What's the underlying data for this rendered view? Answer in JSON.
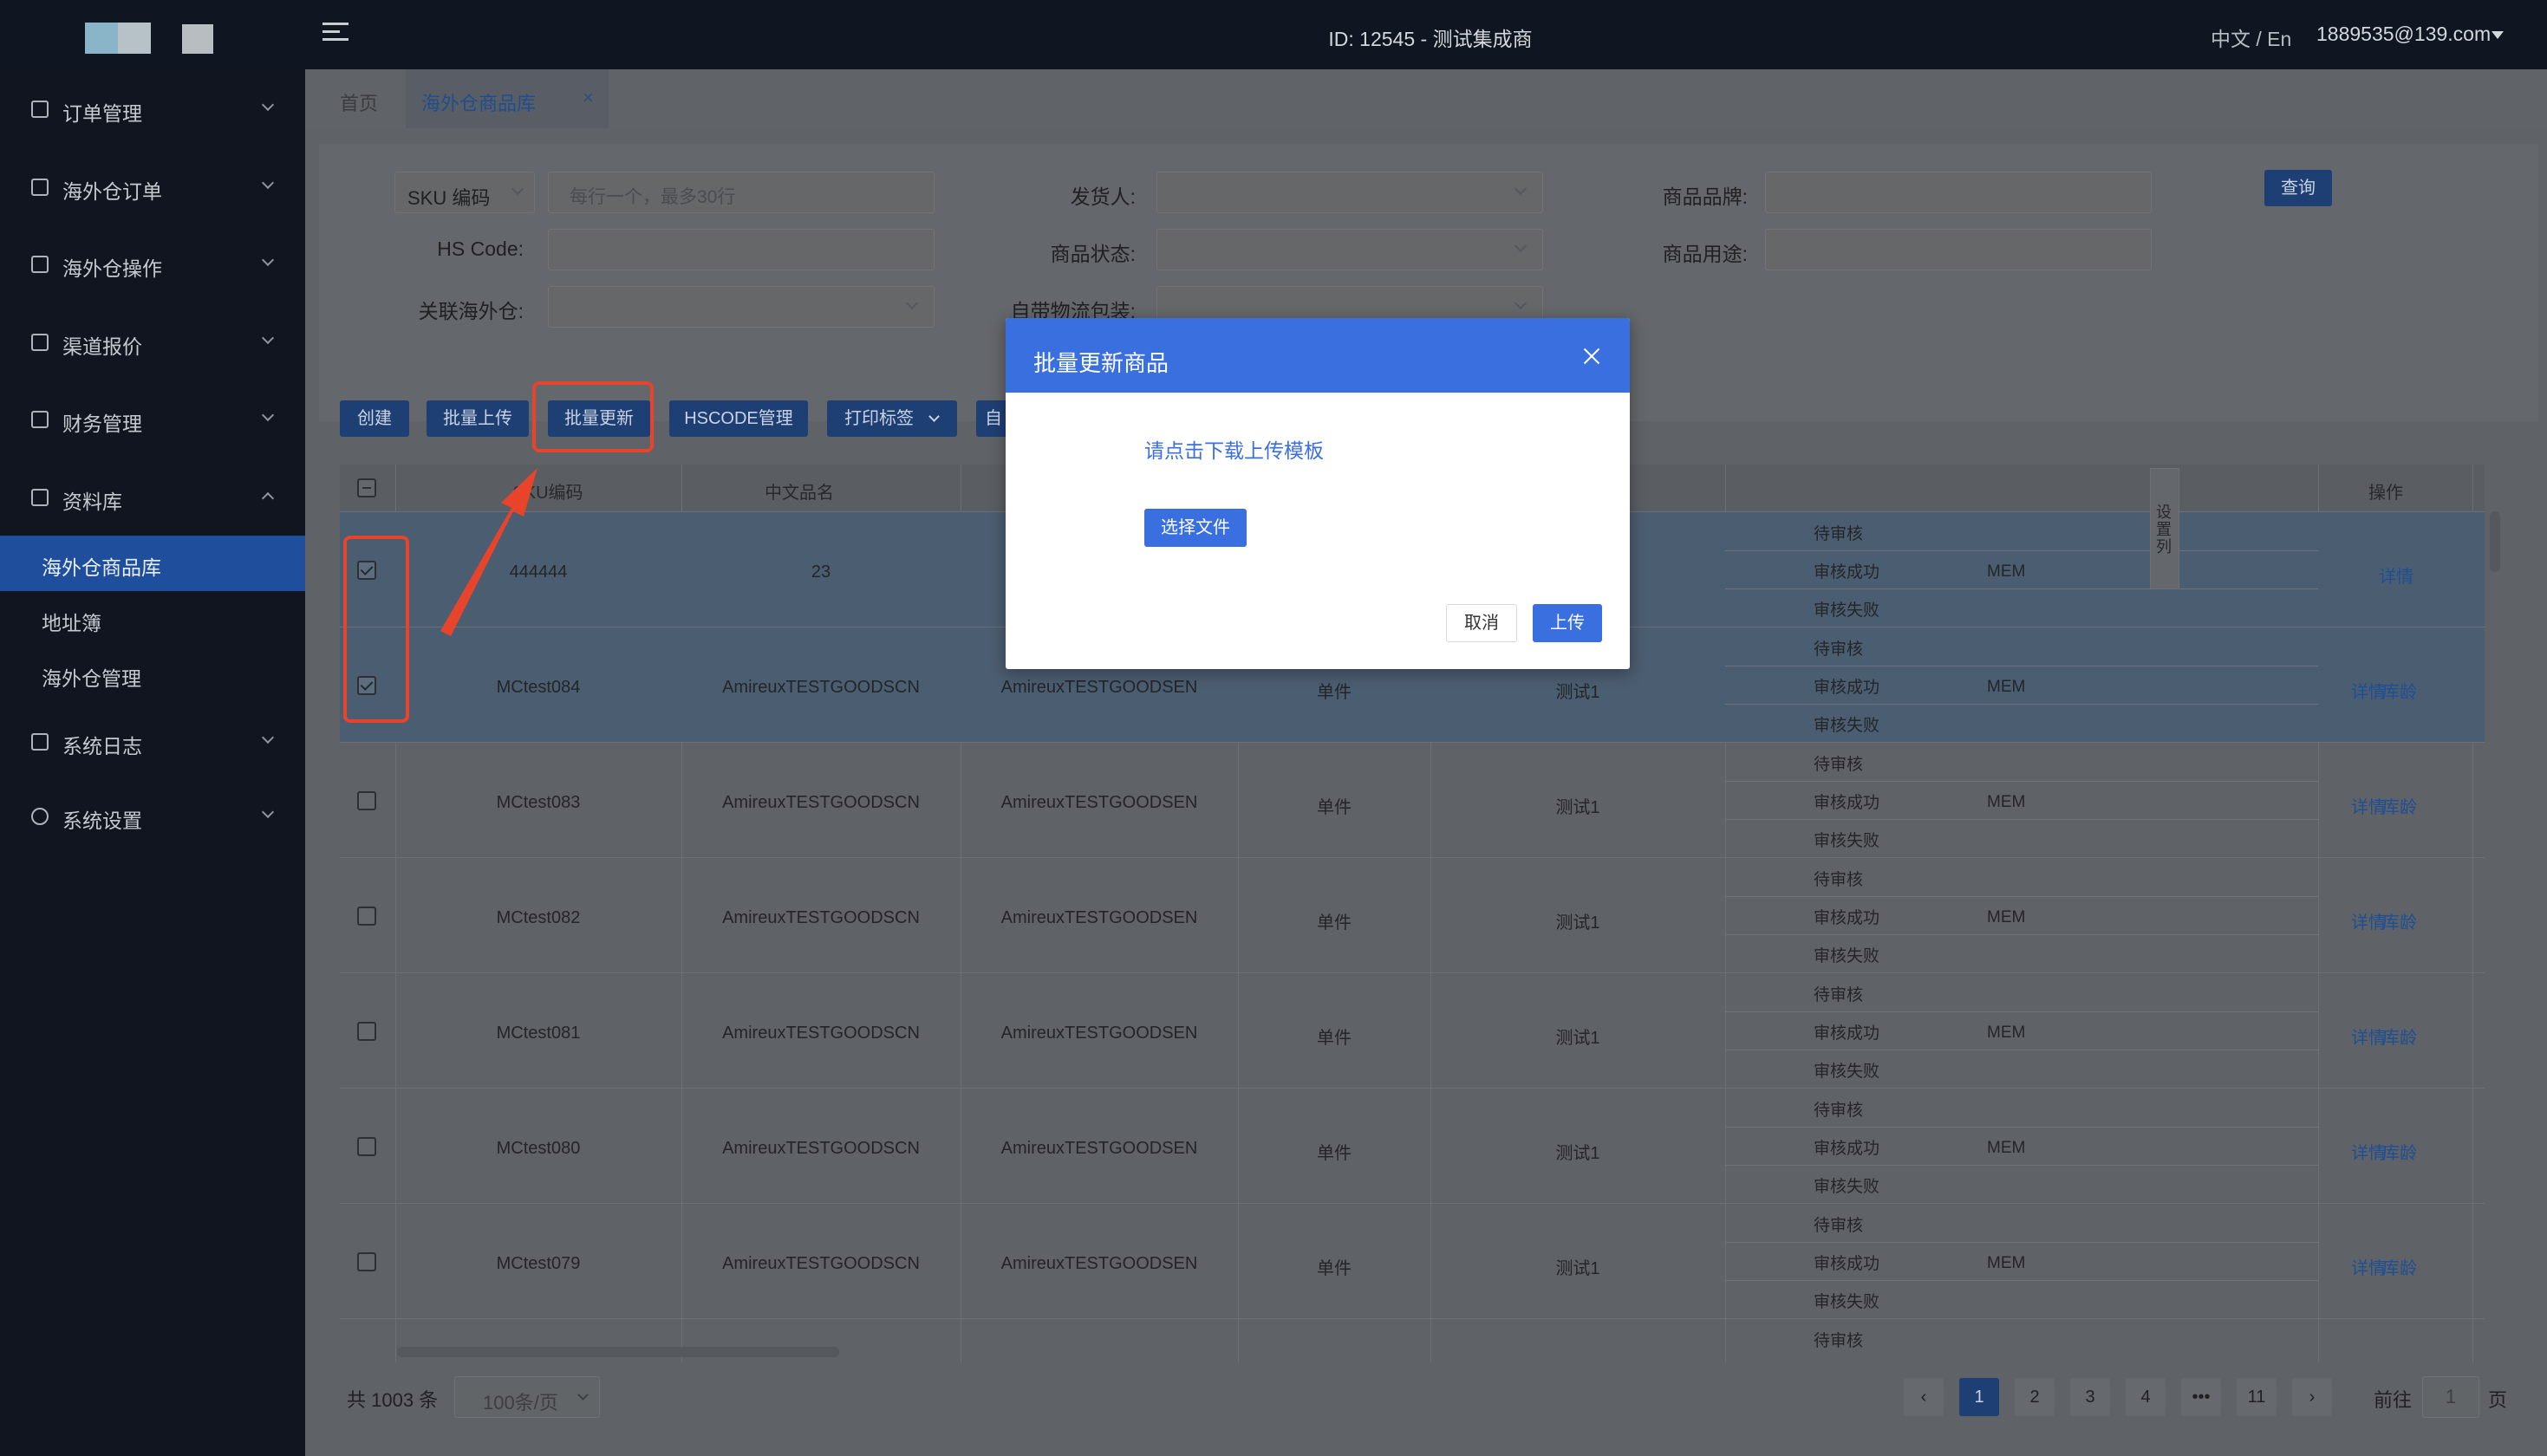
{
  "header": {
    "title": "ID: 12545 - 测试集成商",
    "lang": "中文 / En",
    "user": "1889535@139.com"
  },
  "sidebar": {
    "items": [
      {
        "label": "订单管理",
        "icon": "clipboard-icon"
      },
      {
        "label": "海外仓订单",
        "icon": "document-icon"
      },
      {
        "label": "海外仓操作",
        "icon": "warehouse-icon"
      },
      {
        "label": "渠道报价",
        "icon": "network-icon"
      },
      {
        "label": "财务管理",
        "icon": "coin-icon"
      },
      {
        "label": "资料库",
        "icon": "grid-icon"
      },
      {
        "label": "系统日志",
        "icon": "calendar-icon"
      },
      {
        "label": "系统设置",
        "icon": "gear-icon"
      }
    ],
    "sub_items": [
      {
        "label": "海外仓商品库"
      },
      {
        "label": "地址簿"
      },
      {
        "label": "海外仓管理"
      }
    ]
  },
  "tabs": [
    {
      "label": "首页"
    },
    {
      "label": "海外仓商品库"
    }
  ],
  "filters": {
    "sku_select": "SKU 编码",
    "sku_placeholder": "每行一个，最多30行",
    "hs_code": "HS Code:",
    "warehouse": "关联海外仓:",
    "shipper": "发货人:",
    "status": "商品状态:",
    "own_pack": "自带物流包装:",
    "brand": "商品品牌:",
    "usage": "商品用途:",
    "query": "查询"
  },
  "toolbar": {
    "create": "创建",
    "batch_upload": "批量上传",
    "batch_update": "批量更新",
    "hscode": "HSCODE管理",
    "print": "打印标签",
    "more": "自"
  },
  "table": {
    "headers": {
      "sku": "SKU编码",
      "cn_name": "中文品名",
      "ops": "操作"
    },
    "settings_label": "设置列",
    "audit": [
      "待审核",
      "审核成功",
      "审核失败"
    ],
    "ops_detail": "详情",
    "ops_age": "库龄",
    "rows": [
      {
        "sku": "444444",
        "cn": "23",
        "en": "",
        "unit": "",
        "brand": "",
        "mem": "MEM",
        "selected": true,
        "age": false
      },
      {
        "sku": "MCtest084",
        "cn": "AmireuxTESTGOODSCN",
        "en": "AmireuxTESTGOODSEN",
        "unit": "单件",
        "brand": "测试1",
        "mem": "MEM",
        "selected": true,
        "age": true
      },
      {
        "sku": "MCtest083",
        "cn": "AmireuxTESTGOODSCN",
        "en": "AmireuxTESTGOODSEN",
        "unit": "单件",
        "brand": "测试1",
        "mem": "MEM",
        "selected": false,
        "age": true
      },
      {
        "sku": "MCtest082",
        "cn": "AmireuxTESTGOODSCN",
        "en": "AmireuxTESTGOODSEN",
        "unit": "单件",
        "brand": "测试1",
        "mem": "MEM",
        "selected": false,
        "age": true
      },
      {
        "sku": "MCtest081",
        "cn": "AmireuxTESTGOODSCN",
        "en": "AmireuxTESTGOODSEN",
        "unit": "单件",
        "brand": "测试1",
        "mem": "MEM",
        "selected": false,
        "age": true
      },
      {
        "sku": "MCtest080",
        "cn": "AmireuxTESTGOODSCN",
        "en": "AmireuxTESTGOODSEN",
        "unit": "单件",
        "brand": "测试1",
        "mem": "MEM",
        "selected": false,
        "age": true
      },
      {
        "sku": "MCtest079",
        "cn": "AmireuxTESTGOODSCN",
        "en": "AmireuxTESTGOODSEN",
        "unit": "单件",
        "brand": "测试1",
        "mem": "MEM",
        "selected": false,
        "age": true
      }
    ],
    "last_audit": "待审核"
  },
  "pager": {
    "total": "共 1003 条",
    "page_size": "100条/页",
    "pages": [
      "1",
      "2",
      "3",
      "4",
      "•••",
      "11"
    ],
    "goto": "前往",
    "goto_value": "1",
    "goto_unit": "页"
  },
  "modal": {
    "title": "批量更新商品",
    "link": "请点击下载上传模板",
    "pick": "选择文件",
    "cancel": "取消",
    "upload": "上传"
  },
  "colors": {
    "accent": "#3a6fe0",
    "sidebar_active": "#1f4e9c",
    "annotation": "#e8442c"
  }
}
